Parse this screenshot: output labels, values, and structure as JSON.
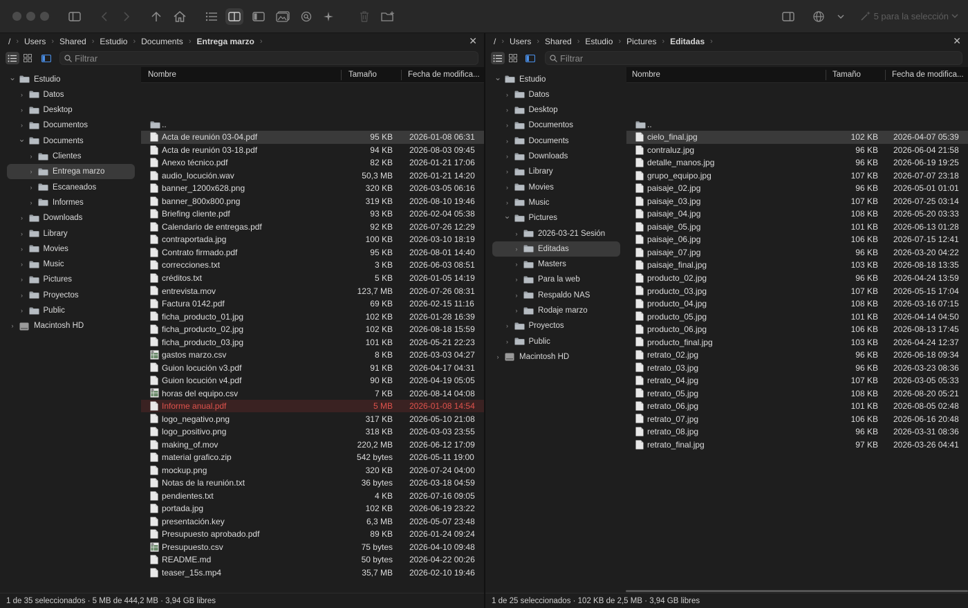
{
  "toolbar": {
    "selection_label": "5 para la selección"
  },
  "left": {
    "path": [
      "Users",
      "Shared",
      "Estudio",
      "Documents",
      "Entrega marzo"
    ],
    "filter_placeholder": "Filtrar",
    "columns": {
      "name": "Nombre",
      "size": "Tamaño",
      "date": "Fecha de modifica..."
    },
    "tree": [
      {
        "label": "Estudio",
        "depth": 0,
        "expanded": true,
        "type": "folder"
      },
      {
        "label": "Datos",
        "depth": 1,
        "type": "folder"
      },
      {
        "label": "Desktop",
        "depth": 1,
        "type": "folder"
      },
      {
        "label": "Documentos",
        "depth": 1,
        "type": "folder"
      },
      {
        "label": "Documents",
        "depth": 1,
        "expanded": true,
        "type": "folder"
      },
      {
        "label": "Clientes",
        "depth": 2,
        "type": "folder"
      },
      {
        "label": "Entrega marzo",
        "depth": 2,
        "type": "folder",
        "selected": true
      },
      {
        "label": "Escaneados",
        "depth": 2,
        "type": "folder"
      },
      {
        "label": "Informes",
        "depth": 2,
        "type": "folder"
      },
      {
        "label": "Downloads",
        "depth": 1,
        "type": "folder"
      },
      {
        "label": "Library",
        "depth": 1,
        "type": "folder"
      },
      {
        "label": "Movies",
        "depth": 1,
        "type": "folder"
      },
      {
        "label": "Music",
        "depth": 1,
        "type": "folder"
      },
      {
        "label": "Pictures",
        "depth": 1,
        "type": "folder"
      },
      {
        "label": "Proyectos",
        "depth": 1,
        "type": "folder"
      },
      {
        "label": "Public",
        "depth": 1,
        "type": "folder"
      },
      {
        "label": "Macintosh HD",
        "depth": 0,
        "type": "disk"
      }
    ],
    "files": [
      {
        "name": "..",
        "size": "",
        "date": "",
        "kind": "folder"
      },
      {
        "name": "Acta de reunión 03-04.pdf",
        "size": "95 KB",
        "date": "2026-01-08 06:31",
        "kind": "doc",
        "state": "sel"
      },
      {
        "name": "Acta de reunión 03-18.pdf",
        "size": "94 KB",
        "date": "2026-08-03 09:45",
        "kind": "doc"
      },
      {
        "name": "Anexo técnico.pdf",
        "size": "82 KB",
        "date": "2026-01-21 17:06",
        "kind": "doc"
      },
      {
        "name": "audio_locución.wav",
        "size": "50,3 MB",
        "date": "2026-01-21 14:20",
        "kind": "doc"
      },
      {
        "name": "banner_1200x628.png",
        "size": "320 KB",
        "date": "2026-03-05 06:16",
        "kind": "doc"
      },
      {
        "name": "banner_800x800.png",
        "size": "319 KB",
        "date": "2026-08-10 19:46",
        "kind": "doc"
      },
      {
        "name": "Briefing cliente.pdf",
        "size": "93 KB",
        "date": "2026-02-04 05:38",
        "kind": "doc"
      },
      {
        "name": "Calendario de entregas.pdf",
        "size": "92 KB",
        "date": "2026-07-26 12:29",
        "kind": "doc"
      },
      {
        "name": "contraportada.jpg",
        "size": "100 KB",
        "date": "2026-03-10 18:19",
        "kind": "doc"
      },
      {
        "name": "Contrato firmado.pdf",
        "size": "95 KB",
        "date": "2026-08-01 14:40",
        "kind": "doc"
      },
      {
        "name": "correcciones.txt",
        "size": "3 KB",
        "date": "2026-06-03 08:51",
        "kind": "doc"
      },
      {
        "name": "créditos.txt",
        "size": "5 KB",
        "date": "2026-01-05 14:19",
        "kind": "doc"
      },
      {
        "name": "entrevista.mov",
        "size": "123,7 MB",
        "date": "2026-07-26 08:31",
        "kind": "doc"
      },
      {
        "name": "Factura 0142.pdf",
        "size": "69 KB",
        "date": "2026-02-15 11:16",
        "kind": "doc"
      },
      {
        "name": "ficha_producto_01.jpg",
        "size": "102 KB",
        "date": "2026-01-28 16:39",
        "kind": "doc"
      },
      {
        "name": "ficha_producto_02.jpg",
        "size": "102 KB",
        "date": "2026-08-18 15:59",
        "kind": "doc"
      },
      {
        "name": "ficha_producto_03.jpg",
        "size": "101 KB",
        "date": "2026-05-21 22:23",
        "kind": "doc"
      },
      {
        "name": "gastos marzo.csv",
        "size": "8 KB",
        "date": "2026-03-03 04:27",
        "kind": "sheet"
      },
      {
        "name": "Guion locución v3.pdf",
        "size": "91 KB",
        "date": "2026-04-17 04:31",
        "kind": "doc"
      },
      {
        "name": "Guion locución v4.pdf",
        "size": "90 KB",
        "date": "2026-04-19 05:05",
        "kind": "doc"
      },
      {
        "name": "horas del equipo.csv",
        "size": "7 KB",
        "date": "2026-08-14 04:08",
        "kind": "sheet"
      },
      {
        "name": "Informe anual.pdf",
        "size": "5 MB",
        "date": "2026-01-08 14:54",
        "kind": "doc",
        "state": "hl"
      },
      {
        "name": "logo_negativo.png",
        "size": "317 KB",
        "date": "2026-05-10 21:08",
        "kind": "doc"
      },
      {
        "name": "logo_positivo.png",
        "size": "318 KB",
        "date": "2026-03-03 23:55",
        "kind": "doc"
      },
      {
        "name": "making_of.mov",
        "size": "220,2 MB",
        "date": "2026-06-12 17:09",
        "kind": "doc"
      },
      {
        "name": "material grafico.zip",
        "size": "542 bytes",
        "date": "2026-05-11 19:00",
        "kind": "doc"
      },
      {
        "name": "mockup.png",
        "size": "320 KB",
        "date": "2026-07-24 04:00",
        "kind": "doc"
      },
      {
        "name": "Notas de la reunión.txt",
        "size": "36 bytes",
        "date": "2026-03-18 04:59",
        "kind": "doc"
      },
      {
        "name": "pendientes.txt",
        "size": "4 KB",
        "date": "2026-07-16 09:05",
        "kind": "doc"
      },
      {
        "name": "portada.jpg",
        "size": "102 KB",
        "date": "2026-06-19 23:22",
        "kind": "doc"
      },
      {
        "name": "presentación.key",
        "size": "6,3 MB",
        "date": "2026-05-07 23:48",
        "kind": "doc"
      },
      {
        "name": "Presupuesto aprobado.pdf",
        "size": "89 KB",
        "date": "2026-01-24 09:24",
        "kind": "doc"
      },
      {
        "name": "Presupuesto.csv",
        "size": "75 bytes",
        "date": "2026-04-10 09:48",
        "kind": "sheet"
      },
      {
        "name": "README.md",
        "size": "50 bytes",
        "date": "2026-04-22 00:26",
        "kind": "doc"
      },
      {
        "name": "teaser_15s.mp4",
        "size": "35,7 MB",
        "date": "2026-02-10 19:46",
        "kind": "doc"
      }
    ],
    "status": "1 de 35 seleccionados · 5 MB de 444,2 MB · 3,94 GB libres"
  },
  "right": {
    "path": [
      "Users",
      "Shared",
      "Estudio",
      "Pictures",
      "Editadas"
    ],
    "filter_placeholder": "Filtrar",
    "columns": {
      "name": "Nombre",
      "size": "Tamaño",
      "date": "Fecha de modifica..."
    },
    "tree": [
      {
        "label": "Estudio",
        "depth": 0,
        "expanded": true,
        "type": "folder"
      },
      {
        "label": "Datos",
        "depth": 1,
        "type": "folder"
      },
      {
        "label": "Desktop",
        "depth": 1,
        "type": "folder"
      },
      {
        "label": "Documentos",
        "depth": 1,
        "type": "folder"
      },
      {
        "label": "Documents",
        "depth": 1,
        "type": "folder"
      },
      {
        "label": "Downloads",
        "depth": 1,
        "type": "folder"
      },
      {
        "label": "Library",
        "depth": 1,
        "type": "folder"
      },
      {
        "label": "Movies",
        "depth": 1,
        "type": "folder"
      },
      {
        "label": "Music",
        "depth": 1,
        "type": "folder"
      },
      {
        "label": "Pictures",
        "depth": 1,
        "expanded": true,
        "type": "folder"
      },
      {
        "label": "2026-03-21 Sesión",
        "depth": 2,
        "type": "folder"
      },
      {
        "label": "Editadas",
        "depth": 2,
        "type": "folder",
        "selected": true
      },
      {
        "label": "Masters",
        "depth": 2,
        "type": "folder"
      },
      {
        "label": "Para la web",
        "depth": 2,
        "type": "folder"
      },
      {
        "label": "Respaldo NAS",
        "depth": 2,
        "type": "folder"
      },
      {
        "label": "Rodaje marzo",
        "depth": 2,
        "type": "folder"
      },
      {
        "label": "Proyectos",
        "depth": 1,
        "type": "folder"
      },
      {
        "label": "Public",
        "depth": 1,
        "type": "folder"
      },
      {
        "label": "Macintosh HD",
        "depth": 0,
        "type": "disk"
      }
    ],
    "files": [
      {
        "name": "..",
        "size": "",
        "date": "",
        "kind": "folder"
      },
      {
        "name": "cielo_final.jpg",
        "size": "102 KB",
        "date": "2026-04-07 05:39",
        "kind": "doc",
        "state": "sel"
      },
      {
        "name": "contraluz.jpg",
        "size": "96 KB",
        "date": "2026-06-04 21:58",
        "kind": "doc"
      },
      {
        "name": "detalle_manos.jpg",
        "size": "96 KB",
        "date": "2026-06-19 19:25",
        "kind": "doc"
      },
      {
        "name": "grupo_equipo.jpg",
        "size": "107 KB",
        "date": "2026-07-07 23:18",
        "kind": "doc"
      },
      {
        "name": "paisaje_02.jpg",
        "size": "96 KB",
        "date": "2026-05-01 01:01",
        "kind": "doc"
      },
      {
        "name": "paisaje_03.jpg",
        "size": "107 KB",
        "date": "2026-07-25 03:14",
        "kind": "doc"
      },
      {
        "name": "paisaje_04.jpg",
        "size": "108 KB",
        "date": "2026-05-20 03:33",
        "kind": "doc"
      },
      {
        "name": "paisaje_05.jpg",
        "size": "101 KB",
        "date": "2026-06-13 01:28",
        "kind": "doc"
      },
      {
        "name": "paisaje_06.jpg",
        "size": "106 KB",
        "date": "2026-07-15 12:41",
        "kind": "doc"
      },
      {
        "name": "paisaje_07.jpg",
        "size": "96 KB",
        "date": "2026-03-20 04:22",
        "kind": "doc"
      },
      {
        "name": "paisaje_final.jpg",
        "size": "103 KB",
        "date": "2026-08-18 13:35",
        "kind": "doc"
      },
      {
        "name": "producto_02.jpg",
        "size": "96 KB",
        "date": "2026-04-24 13:59",
        "kind": "doc"
      },
      {
        "name": "producto_03.jpg",
        "size": "107 KB",
        "date": "2026-05-15 17:04",
        "kind": "doc"
      },
      {
        "name": "producto_04.jpg",
        "size": "108 KB",
        "date": "2026-03-16 07:15",
        "kind": "doc"
      },
      {
        "name": "producto_05.jpg",
        "size": "101 KB",
        "date": "2026-04-14 04:50",
        "kind": "doc"
      },
      {
        "name": "producto_06.jpg",
        "size": "106 KB",
        "date": "2026-08-13 17:45",
        "kind": "doc"
      },
      {
        "name": "producto_final.jpg",
        "size": "103 KB",
        "date": "2026-04-24 12:37",
        "kind": "doc"
      },
      {
        "name": "retrato_02.jpg",
        "size": "96 KB",
        "date": "2026-06-18 09:34",
        "kind": "doc"
      },
      {
        "name": "retrato_03.jpg",
        "size": "96 KB",
        "date": "2026-03-23 08:36",
        "kind": "doc"
      },
      {
        "name": "retrato_04.jpg",
        "size": "107 KB",
        "date": "2026-03-05 05:33",
        "kind": "doc"
      },
      {
        "name": "retrato_05.jpg",
        "size": "108 KB",
        "date": "2026-08-20 05:21",
        "kind": "doc"
      },
      {
        "name": "retrato_06.jpg",
        "size": "101 KB",
        "date": "2026-08-05 02:48",
        "kind": "doc"
      },
      {
        "name": "retrato_07.jpg",
        "size": "106 KB",
        "date": "2026-06-16 20:48",
        "kind": "doc"
      },
      {
        "name": "retrato_08.jpg",
        "size": "96 KB",
        "date": "2026-03-31 08:36",
        "kind": "doc"
      },
      {
        "name": "retrato_final.jpg",
        "size": "97 KB",
        "date": "2026-03-26 04:41",
        "kind": "doc"
      }
    ],
    "status": "1 de 25 seleccionados · 102 KB de 2,5 MB · 3,94 GB libres"
  }
}
